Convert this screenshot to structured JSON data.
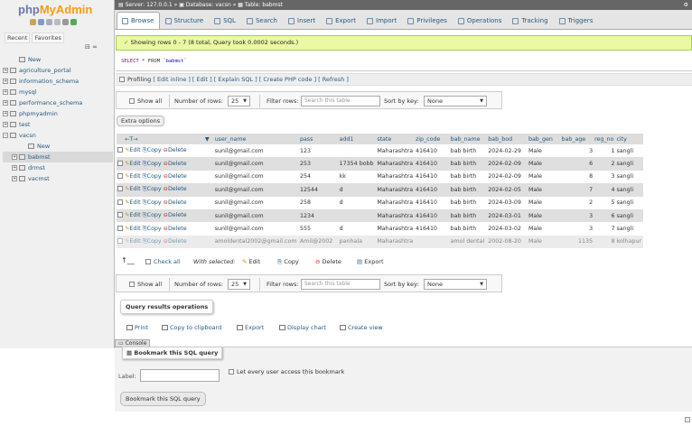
{
  "sidebar": {
    "logo_part1": "php",
    "logo_part2": "MyAdmin",
    "tab_recent": "Recent",
    "tab_favorites": "Favorites",
    "collapse": "⊟ ∞",
    "tree": [
      {
        "label": "New",
        "level": 1,
        "expander": ""
      },
      {
        "label": "agriculture_portal",
        "level": 0,
        "expander": "+"
      },
      {
        "label": "information_schema",
        "level": 0,
        "expander": "+"
      },
      {
        "label": "mysql",
        "level": 0,
        "expander": "+"
      },
      {
        "label": "performance_schema",
        "level": 0,
        "expander": "+"
      },
      {
        "label": "phpmyadmin",
        "level": 0,
        "expander": "+"
      },
      {
        "label": "test",
        "level": 0,
        "expander": "+"
      },
      {
        "label": "vacsn",
        "level": 0,
        "expander": "−"
      },
      {
        "label": "New",
        "level": 2,
        "expander": ""
      },
      {
        "label": "babmst",
        "level": 1,
        "expander": "+"
      },
      {
        "label": "drmst",
        "level": 1,
        "expander": "+"
      },
      {
        "label": "vacmst",
        "level": 1,
        "expander": "+"
      }
    ]
  },
  "breadcrumb": {
    "server": "Server: 127.0.0.1",
    "database": "Database: vacsn",
    "table": "Table: babmst"
  },
  "tabs": [
    "Browse",
    "Structure",
    "SQL",
    "Search",
    "Insert",
    "Export",
    "Import",
    "Privileges",
    "Operations",
    "Tracking",
    "Triggers"
  ],
  "success": "Showing rows 0 - 7 (8 total, Query took 0.0002 seconds.)",
  "sql": {
    "kw": "SELECT",
    "rest": " * FROM ",
    "table": "`babmst`"
  },
  "profiling": {
    "label": "Profiling",
    "links": "[ Edit inline ] [ Edit ] [ Explain SQL ] [ Create PHP code ] [ Refresh ]"
  },
  "nav": {
    "show_all": "Show all",
    "num_rows_label": "Number of rows:",
    "num_rows_value": "25",
    "filter_label": "Filter rows:",
    "filter_placeholder": "Search this table",
    "sort_label": "Sort by key:",
    "sort_value": "None"
  },
  "extra_options": "Extra options",
  "table": {
    "nav_arrows": "←T→",
    "sort_arrow": "▼",
    "columns": [
      "user_name",
      "pass",
      "add1",
      "state",
      "zip_code",
      "bab_name",
      "bab_bod",
      "bab_gen",
      "bab_age",
      "reg_no",
      "city"
    ],
    "action_edit": "Edit",
    "action_copy": "Copy",
    "action_delete": "Delete",
    "rows": [
      [
        "sunil@gmail.com",
        "123",
        "",
        "Maharashtra",
        "416410",
        "bab birth",
        "2024-02-29",
        "Male",
        "3",
        "1",
        "sangli"
      ],
      [
        "sunil@gmail.com",
        "253",
        "17354 bobb",
        "Maharashtra",
        "416410",
        "bab birth",
        "2024-02-09",
        "Male",
        "6",
        "2",
        "sangli"
      ],
      [
        "sunil@gmail.com",
        "254",
        "kk",
        "Maharashtra",
        "416410",
        "bab birth",
        "2024-02-09",
        "Male",
        "8",
        "3",
        "sangli"
      ],
      [
        "sunil@gmail.com",
        "12544",
        "d",
        "Maharashtra",
        "416410",
        "bab birth",
        "2024-02-05",
        "Male",
        "7",
        "4",
        "sangli"
      ],
      [
        "sunil@gmail.com",
        "258",
        "d",
        "Maharashtra",
        "416410",
        "bab birth",
        "2024-03-09",
        "Male",
        "2",
        "5",
        "sangli"
      ],
      [
        "sunil@gmail.com",
        "1234",
        "",
        "Maharashtra",
        "416410",
        "bab birth",
        "2024-03-01",
        "Male",
        "3",
        "6",
        "sangli"
      ],
      [
        "sunil@gmail.com",
        "555",
        "d",
        "Maharashtra",
        "416410",
        "bab birth",
        "2024-03-02",
        "Male",
        "3",
        "7",
        "sangli"
      ],
      [
        "amoldental2002@gmail.com",
        "Amil@2002",
        "panhala",
        "Maharashtra",
        "",
        "amol dental",
        "2002-08-20",
        "Male",
        "1135",
        "8",
        "kolhapur"
      ]
    ]
  },
  "with_selected": {
    "arrow": "↑__",
    "check_all": "Check all",
    "label": "With selected:",
    "edit": "Edit",
    "copy": "Copy",
    "delete": "Delete",
    "export": "Export"
  },
  "query_ops": {
    "title": "Query results operations",
    "print": "Print",
    "clipboard": "Copy to clipboard",
    "export": "Export",
    "chart": "Display chart",
    "view": "Create view"
  },
  "console": "Console",
  "bookmark": {
    "title": "Bookmark this SQL query",
    "label": "Label:",
    "every_user": "Let every user access this bookmark",
    "button": "Bookmark this SQL query"
  }
}
